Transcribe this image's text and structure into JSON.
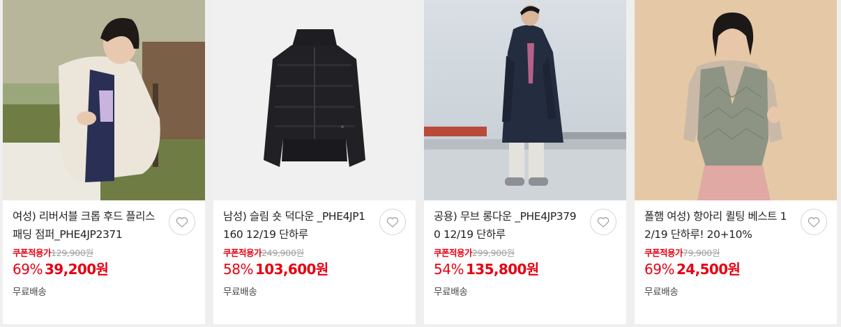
{
  "products": [
    {
      "title": "여성) 리버서블 크롭 후드 플리스 패딩 점퍼_PHE4JP2371",
      "image_alt": "woman wearing reversible fleece cropped hooded jacket",
      "coupon_label": "쿠폰적용가",
      "original_price": "129,900원",
      "discount_rate": "69%",
      "sale_price": "39,200원",
      "shipping": "무료배송"
    },
    {
      "title": "남성) 슬림 숏 덕다운 _PHE4JP1160 12/19 단하루",
      "image_alt": "black short duck down puffer jacket",
      "coupon_label": "쿠폰적용가",
      "original_price": "249,900원",
      "discount_rate": "58%",
      "sale_price": "103,600원",
      "shipping": "무료배송"
    },
    {
      "title": "공용) 무브 롱다운 _PHE4JP3790 12/19 단하루",
      "image_alt": "man wearing long navy down coat on rooftop",
      "coupon_label": "쿠폰적용가",
      "original_price": "299,900원",
      "discount_rate": "54%",
      "sale_price": "135,800원",
      "shipping": "무료배송"
    },
    {
      "title": "폴햄 여성) 항아리 퀼팅 베스트 12/19 단하루! 20+10%",
      "image_alt": "woman wearing khaki quilted vest",
      "coupon_label": "쿠폰적용가",
      "original_price": "79,900원",
      "discount_rate": "69%",
      "sale_price": "24,500원",
      "shipping": "무료배송"
    }
  ],
  "icons": {
    "wishlist": "heart-outline-icon"
  },
  "colors": {
    "accent": "#e60012",
    "strike": "#a0a0a0",
    "text": "#222222"
  }
}
